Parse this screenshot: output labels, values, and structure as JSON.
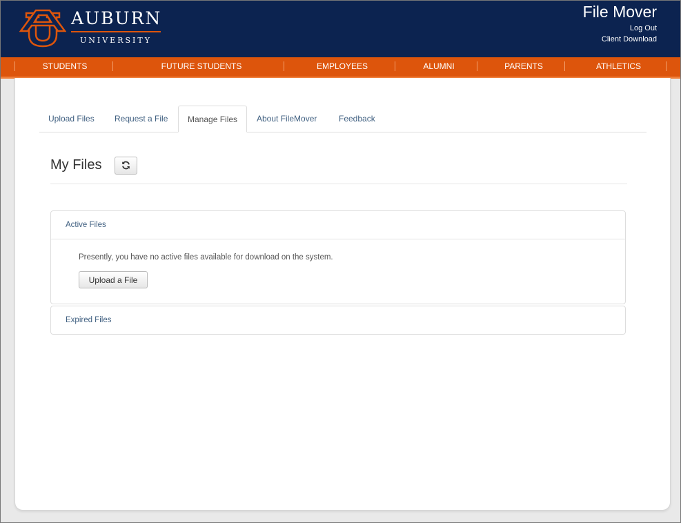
{
  "header": {
    "logo_word": "AUBURN",
    "logo_sub": "UNIVERSITY",
    "app_title": "File Mover",
    "logout_label": "Log Out",
    "client_download_label": "Client Download"
  },
  "nav": {
    "items": [
      {
        "label": "STUDENTS"
      },
      {
        "label": "FUTURE STUDENTS"
      },
      {
        "label": "EMPLOYEES"
      },
      {
        "label": "ALUMNI"
      },
      {
        "label": "PARENTS"
      },
      {
        "label": "ATHLETICS"
      }
    ]
  },
  "tabs": {
    "items": [
      {
        "label": "Upload Files"
      },
      {
        "label": "Request a File"
      },
      {
        "label": "Manage Files",
        "active": true
      },
      {
        "label": "About FileMover"
      },
      {
        "label": "Feedback"
      }
    ]
  },
  "main": {
    "page_title": "My Files",
    "refresh_icon": "refresh-icon",
    "active_panel": {
      "heading": "Active Files",
      "message": "Presently, you have no active files available for download on the system.",
      "upload_button_label": "Upload a File"
    },
    "expired_panel": {
      "heading": "Expired Files"
    }
  },
  "colors": {
    "navy": "#0c2350",
    "orange": "#dd550c",
    "link": "#3f5f80"
  }
}
